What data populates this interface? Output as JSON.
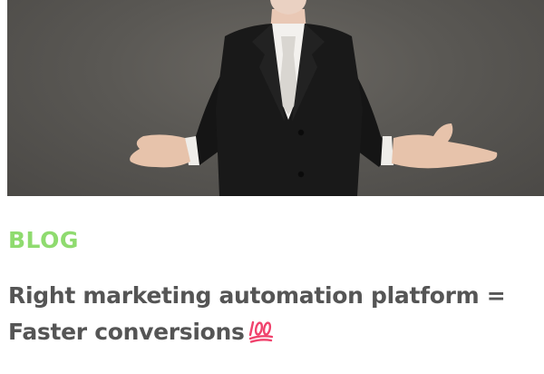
{
  "post": {
    "category": "BLOG",
    "title_line1": "Right marketing automation platform =",
    "title_line2": "Faster conversions",
    "title_emoji": "hundred-points-icon"
  },
  "colors": {
    "category": "#8fdb6f",
    "title": "#555555",
    "emoji": "#f0436d"
  }
}
